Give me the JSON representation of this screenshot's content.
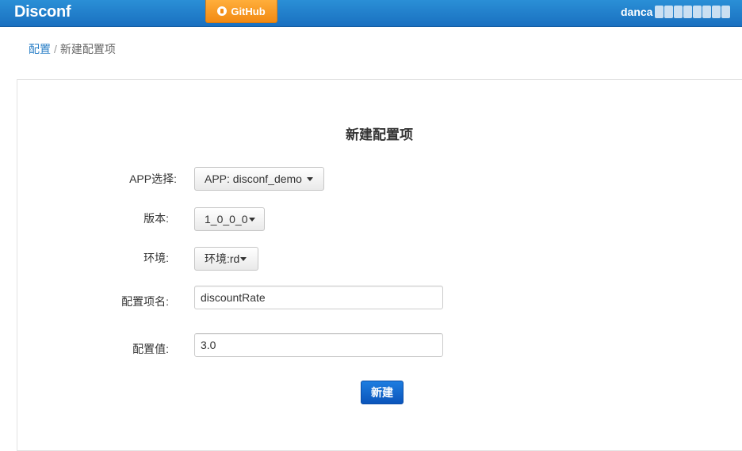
{
  "navbar": {
    "brand": "Disconf",
    "github_label": "GitHub",
    "user_visible": "danca"
  },
  "breadcrumb": {
    "parent": "配置",
    "separator": "/",
    "current": "新建配置项"
  },
  "form": {
    "title": "新建配置项",
    "app": {
      "label": "APP选择:",
      "value": "APP: disconf_demo"
    },
    "version": {
      "label": "版本:",
      "value": "1_0_0_0"
    },
    "env": {
      "label": "环境:",
      "value": "环境:rd"
    },
    "key": {
      "label": "配置项名:",
      "value": "discountRate"
    },
    "val": {
      "label": "配置值:",
      "value": "3.0"
    },
    "submit_label": "新建"
  },
  "colors": {
    "navbar": "#1a70c0",
    "github_button": "#f28a13",
    "link": "#2a7fc7",
    "primary_button": "#0b55bb"
  },
  "icons": {
    "github": "github-icon",
    "caret": "caret-down-icon"
  }
}
